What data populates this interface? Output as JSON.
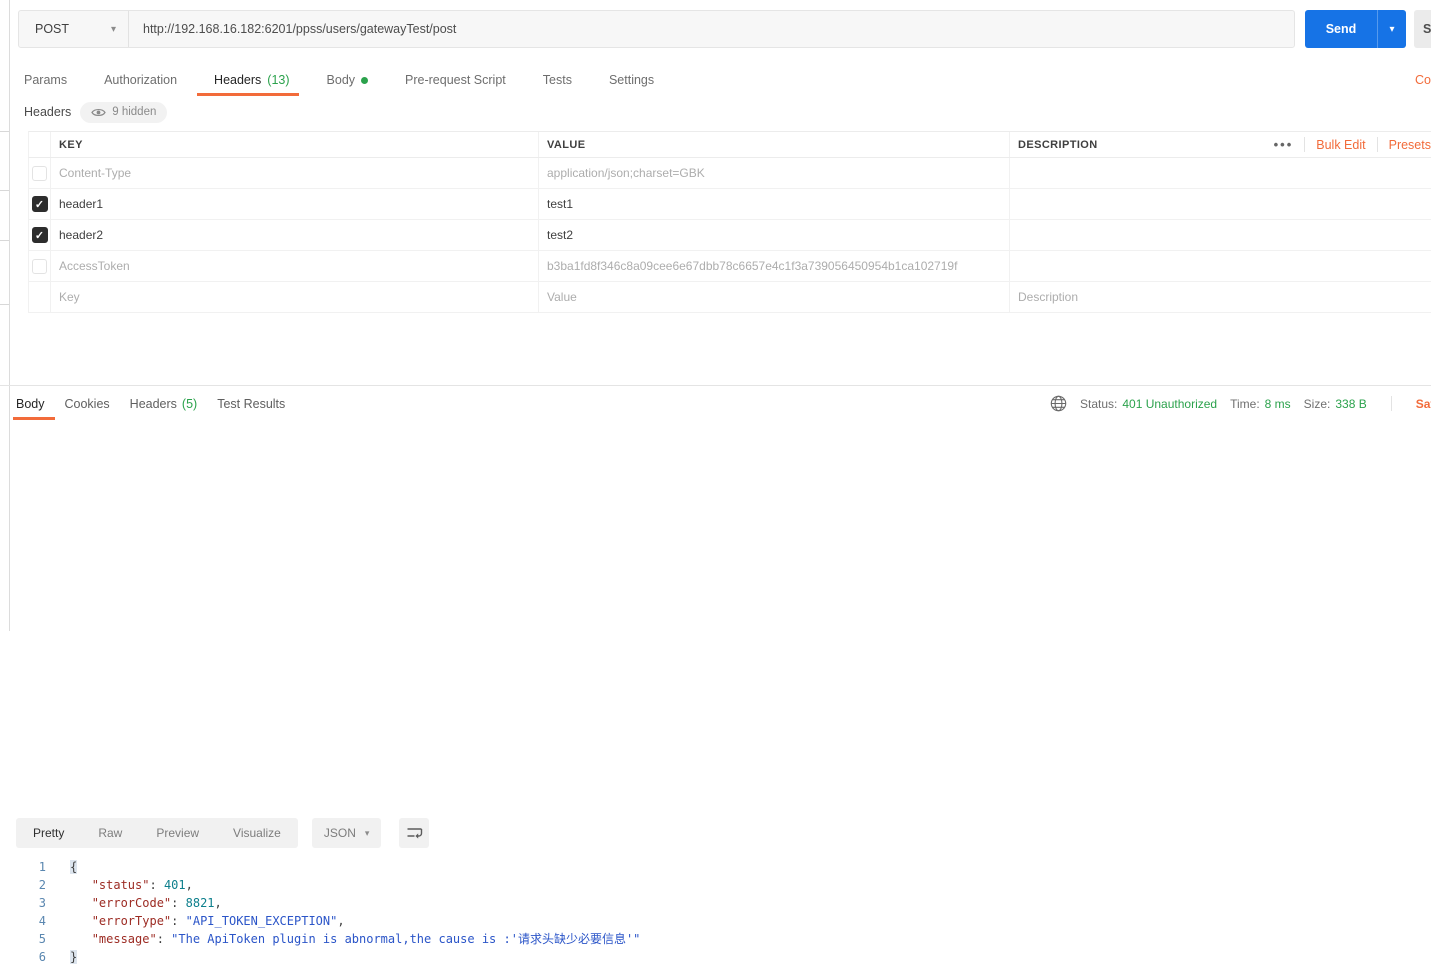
{
  "colors": {
    "orange": "#F26B3A",
    "blue": "#1673E6",
    "green": "#2BA24C",
    "input_bg": "#f7f7f7",
    "lineno": "#5A87B0",
    "tok_key": "#9C2B23",
    "tok_str": "#2B55C8",
    "tok_num": "#0D7F8C"
  },
  "request": {
    "method": "POST",
    "url": "http://192.168.16.182:6201/ppss/users/gatewayTest/post",
    "send_label": "Send",
    "save_label": "Save",
    "cookies_link": "Cookies",
    "tabs": [
      {
        "label": "Params"
      },
      {
        "label": "Authorization"
      },
      {
        "label": "Headers",
        "count": "(13)",
        "active": true
      },
      {
        "label": "Body",
        "dot": true
      },
      {
        "label": "Pre-request Script"
      },
      {
        "label": "Tests"
      },
      {
        "label": "Settings"
      }
    ],
    "headers_section": {
      "title": "Headers",
      "hidden_badge": "9 hidden",
      "columns": {
        "key": "KEY",
        "value": "VALUE",
        "description": "DESCRIPTION"
      },
      "bulk_edit_label": "Bulk Edit",
      "presets_label": "Presets",
      "rows": [
        {
          "key": "Content-Type",
          "value": "application/json;charset=GBK",
          "description": "",
          "checkbox": false,
          "disabled": true
        },
        {
          "key": "header1",
          "value": "test1",
          "description": "",
          "checkbox": true,
          "drag_handle": true
        },
        {
          "key": "header2",
          "value": "test2",
          "description": "",
          "checkbox": true
        },
        {
          "key": "AccessToken",
          "value": "b3ba1fd8f346c8a09cee6e67dbb78c6657e4c1f3a739056450954b1ca102719f",
          "description": "",
          "checkbox": false,
          "disabled": true
        },
        {
          "key": "Key",
          "value": "Value",
          "description": "Description",
          "placeholder": true
        }
      ]
    }
  },
  "response": {
    "tabs": [
      {
        "label": "Body",
        "active": true
      },
      {
        "label": "Cookies"
      },
      {
        "label": "Headers",
        "count": "(5)"
      },
      {
        "label": "Test Results"
      }
    ],
    "meta": {
      "status_label": "Status:",
      "status_value": "401 Unauthorized",
      "time_label": "Time:",
      "time_value": "8 ms",
      "size_label": "Size:",
      "size_value": "338 B",
      "save_label": "Save Response"
    },
    "view_tabs": [
      {
        "label": "Pretty",
        "active": true
      },
      {
        "label": "Raw"
      },
      {
        "label": "Preview"
      },
      {
        "label": "Visualize"
      }
    ],
    "format": "JSON",
    "body_lines": [
      {
        "n": "1",
        "tokens": [
          {
            "c": "brk",
            "v": "{"
          }
        ]
      },
      {
        "n": "2",
        "tokens": [
          {
            "c": "pln",
            "v": "   "
          },
          {
            "c": "key",
            "v": "\"status\""
          },
          {
            "c": "pln",
            "v": ": "
          },
          {
            "c": "num",
            "v": "401"
          },
          {
            "c": "pln",
            "v": ","
          }
        ]
      },
      {
        "n": "3",
        "tokens": [
          {
            "c": "pln",
            "v": "   "
          },
          {
            "c": "key",
            "v": "\"errorCode\""
          },
          {
            "c": "pln",
            "v": ": "
          },
          {
            "c": "num",
            "v": "8821"
          },
          {
            "c": "pln",
            "v": ","
          }
        ]
      },
      {
        "n": "4",
        "tokens": [
          {
            "c": "pln",
            "v": "   "
          },
          {
            "c": "key",
            "v": "\"errorType\""
          },
          {
            "c": "pln",
            "v": ": "
          },
          {
            "c": "str",
            "v": "\"API_TOKEN_EXCEPTION\""
          },
          {
            "c": "pln",
            "v": ","
          }
        ]
      },
      {
        "n": "5",
        "tokens": [
          {
            "c": "pln",
            "v": "   "
          },
          {
            "c": "key",
            "v": "\"message\""
          },
          {
            "c": "pln",
            "v": ": "
          },
          {
            "c": "str",
            "v": "\"The ApiToken plugin is abnormal,the cause is :'请求头缺少必要信息'\""
          }
        ]
      },
      {
        "n": "6",
        "tokens": [
          {
            "c": "brk",
            "v": "}"
          }
        ]
      }
    ]
  },
  "icons": {
    "chevron_down": "▾",
    "more_options": "•••",
    "checkmark": "✓"
  }
}
